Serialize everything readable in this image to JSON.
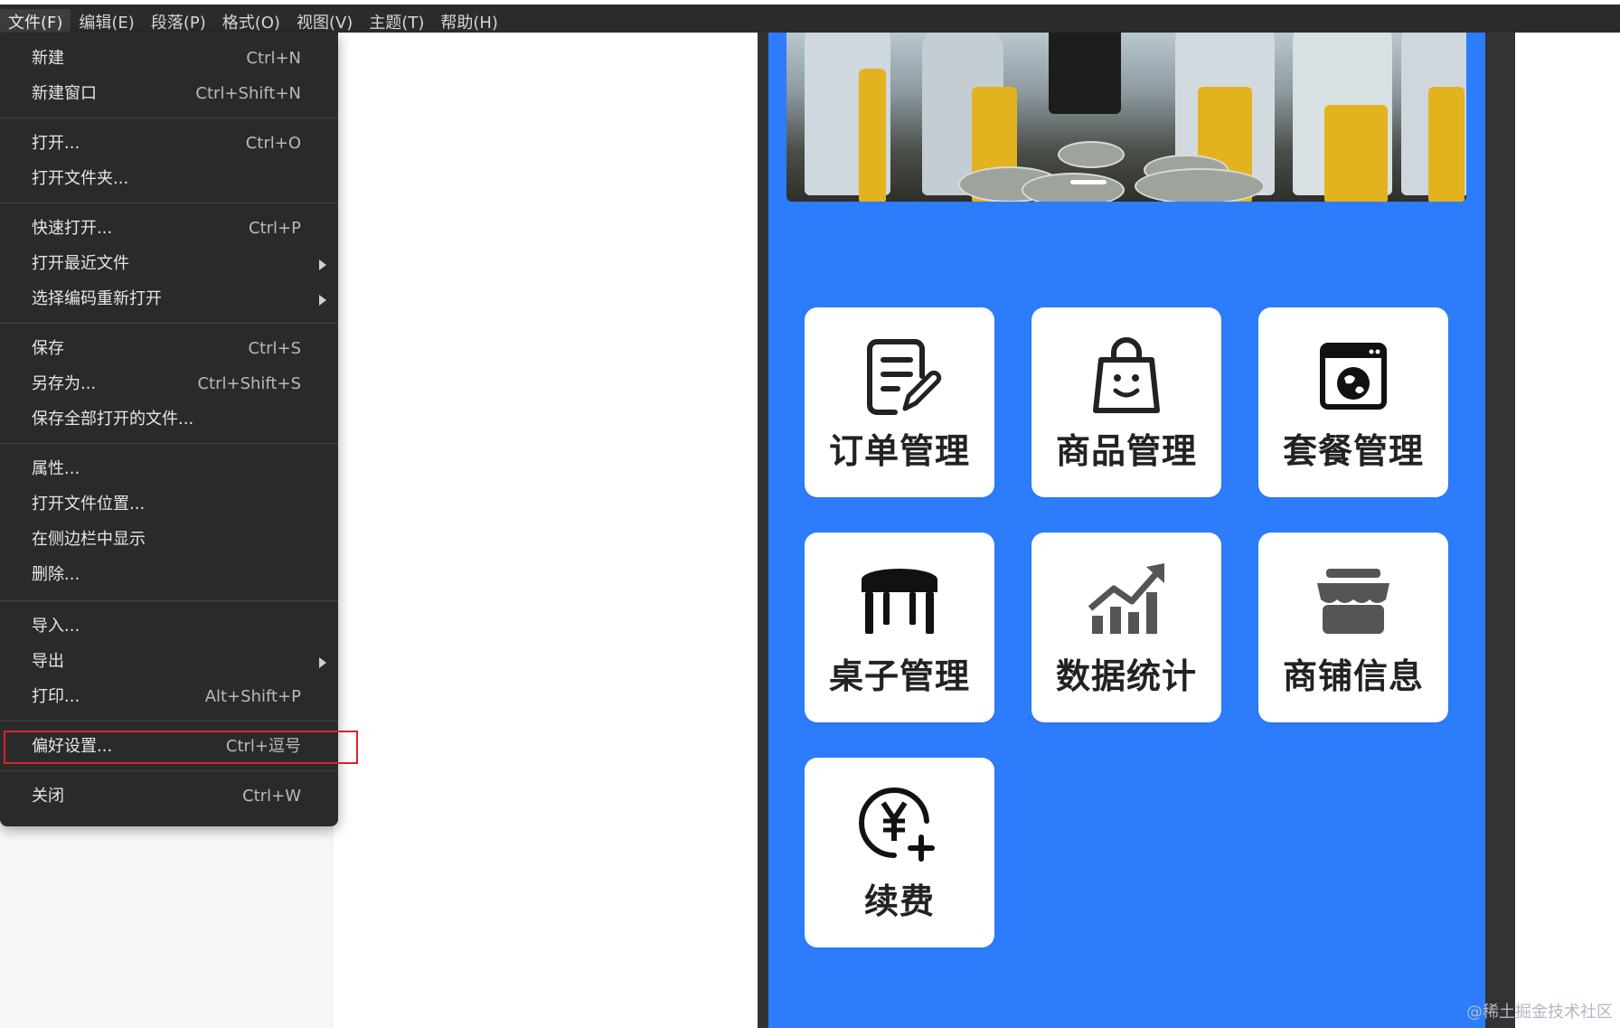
{
  "menubar": {
    "items": [
      "文件(F)",
      "编辑(E)",
      "段落(P)",
      "格式(O)",
      "视图(V)",
      "主题(T)",
      "帮助(H)"
    ]
  },
  "file_menu": {
    "items": [
      {
        "label": "新建",
        "shortcut": "Ctrl+N"
      },
      {
        "label": "新建窗口",
        "shortcut": "Ctrl+Shift+N"
      },
      {
        "label": "打开...",
        "shortcut": "Ctrl+O"
      },
      {
        "label": "打开文件夹...",
        "shortcut": ""
      },
      {
        "label": "快速打开...",
        "shortcut": "Ctrl+P"
      },
      {
        "label": "打开最近文件",
        "shortcut": ""
      },
      {
        "label": "选择编码重新打开",
        "shortcut": ""
      },
      {
        "label": "保存",
        "shortcut": "Ctrl+S"
      },
      {
        "label": "另存为...",
        "shortcut": "Ctrl+Shift+S"
      },
      {
        "label": "保存全部打开的文件...",
        "shortcut": ""
      },
      {
        "label": "属性...",
        "shortcut": ""
      },
      {
        "label": "打开文件位置...",
        "shortcut": ""
      },
      {
        "label": "在侧边栏中显示",
        "shortcut": ""
      },
      {
        "label": "删除...",
        "shortcut": ""
      },
      {
        "label": "导入...",
        "shortcut": ""
      },
      {
        "label": "导出",
        "shortcut": ""
      },
      {
        "label": "打印...",
        "shortcut": "Alt+Shift+P"
      },
      {
        "label": "偏好设置...",
        "shortcut": "Ctrl+逗号"
      },
      {
        "label": "关闭",
        "shortcut": "Ctrl+W"
      }
    ]
  },
  "app_preview": {
    "tiles": [
      {
        "label": "订单管理",
        "icon": "order-edit-icon"
      },
      {
        "label": "商品管理",
        "icon": "shopping-bag-icon"
      },
      {
        "label": "套餐管理",
        "icon": "package-globe-icon"
      },
      {
        "label": "桌子管理",
        "icon": "table-icon"
      },
      {
        "label": "数据统计",
        "icon": "stats-chart-icon"
      },
      {
        "label": "商铺信息",
        "icon": "store-icon"
      },
      {
        "label": "续费",
        "icon": "yuan-plus-icon"
      }
    ]
  },
  "watermark": "@稀土掘金技术社区",
  "colors": {
    "menubar_bg": "#2b2b2b",
    "menu_bg": "#2a2a2b",
    "phone_bg": "#2c7cfb",
    "highlight": "#d8232a"
  }
}
